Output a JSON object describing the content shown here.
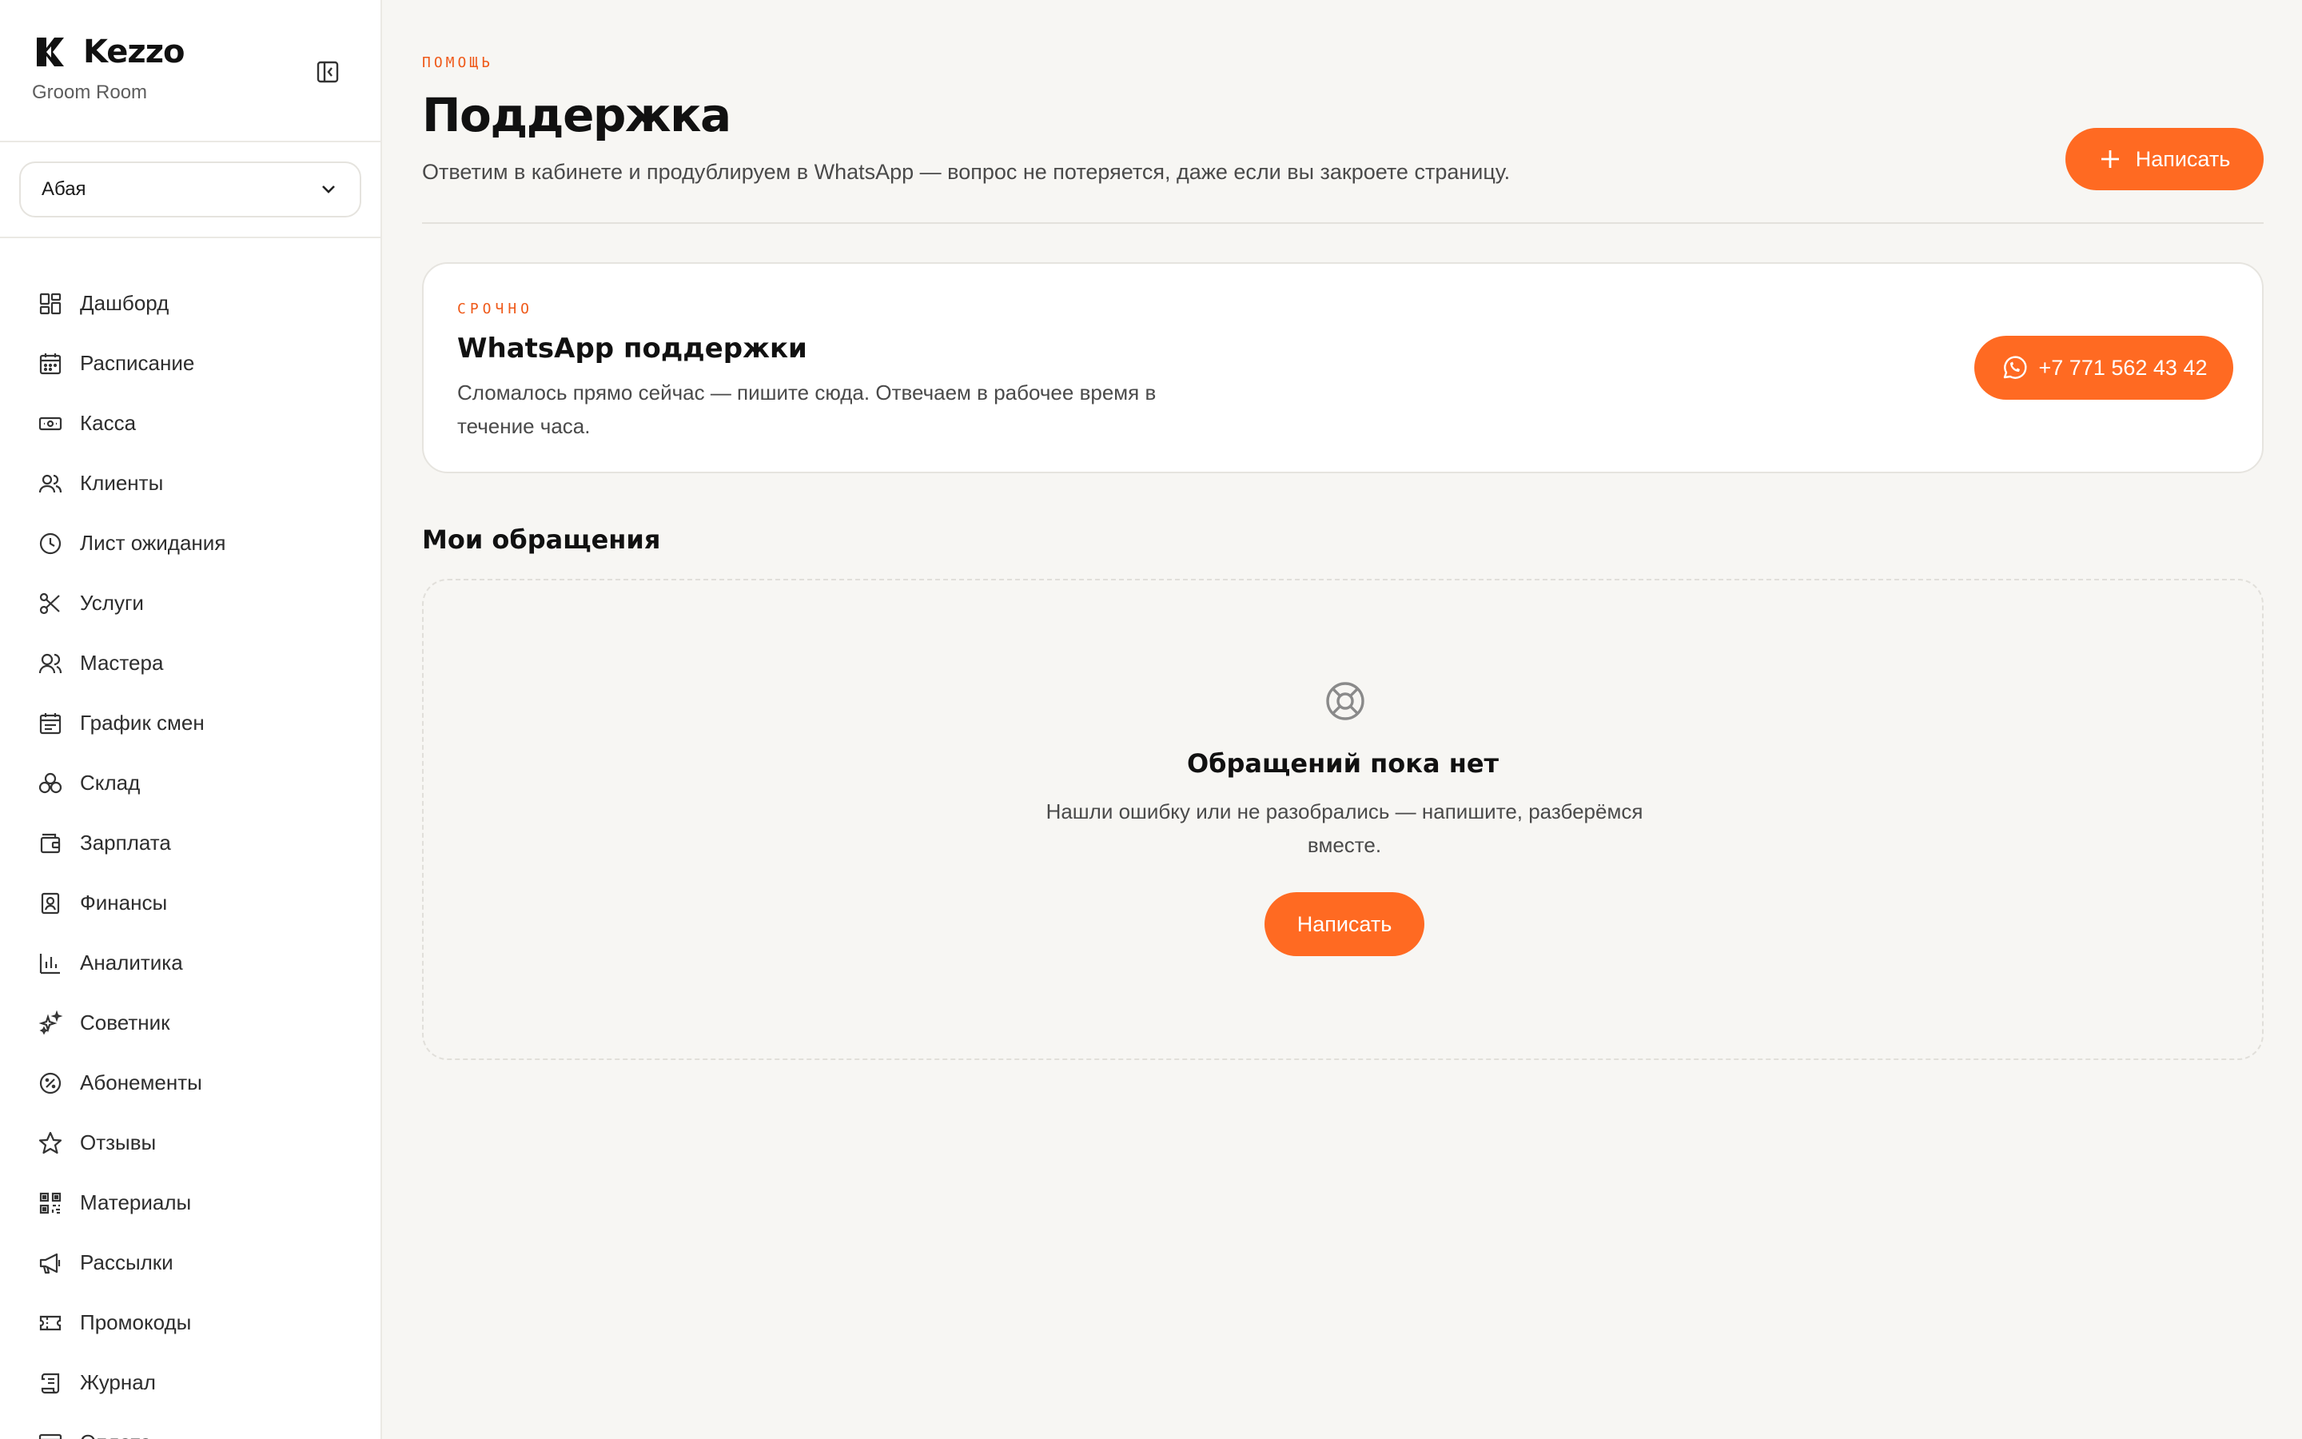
{
  "brand": {
    "name": "Kezzo",
    "salon": "Groom Room"
  },
  "branch_select": {
    "value": "Абая"
  },
  "nav": [
    {
      "label": "Дашборд",
      "icon": "dashboard-icon"
    },
    {
      "label": "Расписание",
      "icon": "calendar-icon"
    },
    {
      "label": "Касса",
      "icon": "cash-icon"
    },
    {
      "label": "Клиенты",
      "icon": "clients-icon"
    },
    {
      "label": "Лист ожидания",
      "icon": "clock-icon"
    },
    {
      "label": "Услуги",
      "icon": "scissors-icon"
    },
    {
      "label": "Мастера",
      "icon": "masters-icon"
    },
    {
      "label": "График смен",
      "icon": "shift-calendar-icon"
    },
    {
      "label": "Склад",
      "icon": "warehouse-icon"
    },
    {
      "label": "Зарплата",
      "icon": "wallet-icon"
    },
    {
      "label": "Финансы",
      "icon": "finance-icon"
    },
    {
      "label": "Аналитика",
      "icon": "analytics-icon"
    },
    {
      "label": "Советник",
      "icon": "sparkles-icon"
    },
    {
      "label": "Абонементы",
      "icon": "subscription-icon"
    },
    {
      "label": "Отзывы",
      "icon": "star-icon"
    },
    {
      "label": "Материалы",
      "icon": "qr-icon"
    },
    {
      "label": "Рассылки",
      "icon": "megaphone-icon"
    },
    {
      "label": "Промокоды",
      "icon": "ticket-icon"
    },
    {
      "label": "Журнал",
      "icon": "scroll-icon"
    },
    {
      "label": "Оплата",
      "icon": "card-icon"
    }
  ],
  "header": {
    "eyebrow": "ПОМОЩЬ",
    "title": "Поддержка",
    "subtitle": "Ответим в кабинете и продублируем в WhatsApp — вопрос не потеряется, даже если вы закроете страницу.",
    "write_button": "Написать"
  },
  "urgent": {
    "eyebrow": "СРОЧНО",
    "title": "WhatsApp поддержки",
    "text": "Сломалось прямо сейчас — пишите сюда. Отвечаем в рабочее время в течение часа.",
    "phone": "+7 771 562 43 42"
  },
  "tickets": {
    "title": "Мои обращения",
    "empty_title": "Обращений пока нет",
    "empty_text": "Нашли ошибку или не разобрались — напишите, разберёмся вместе.",
    "empty_button": "Написать"
  },
  "colors": {
    "accent": "#ff6a22",
    "eyebrow": "#ef5a1a",
    "background": "#f7f6f3"
  }
}
